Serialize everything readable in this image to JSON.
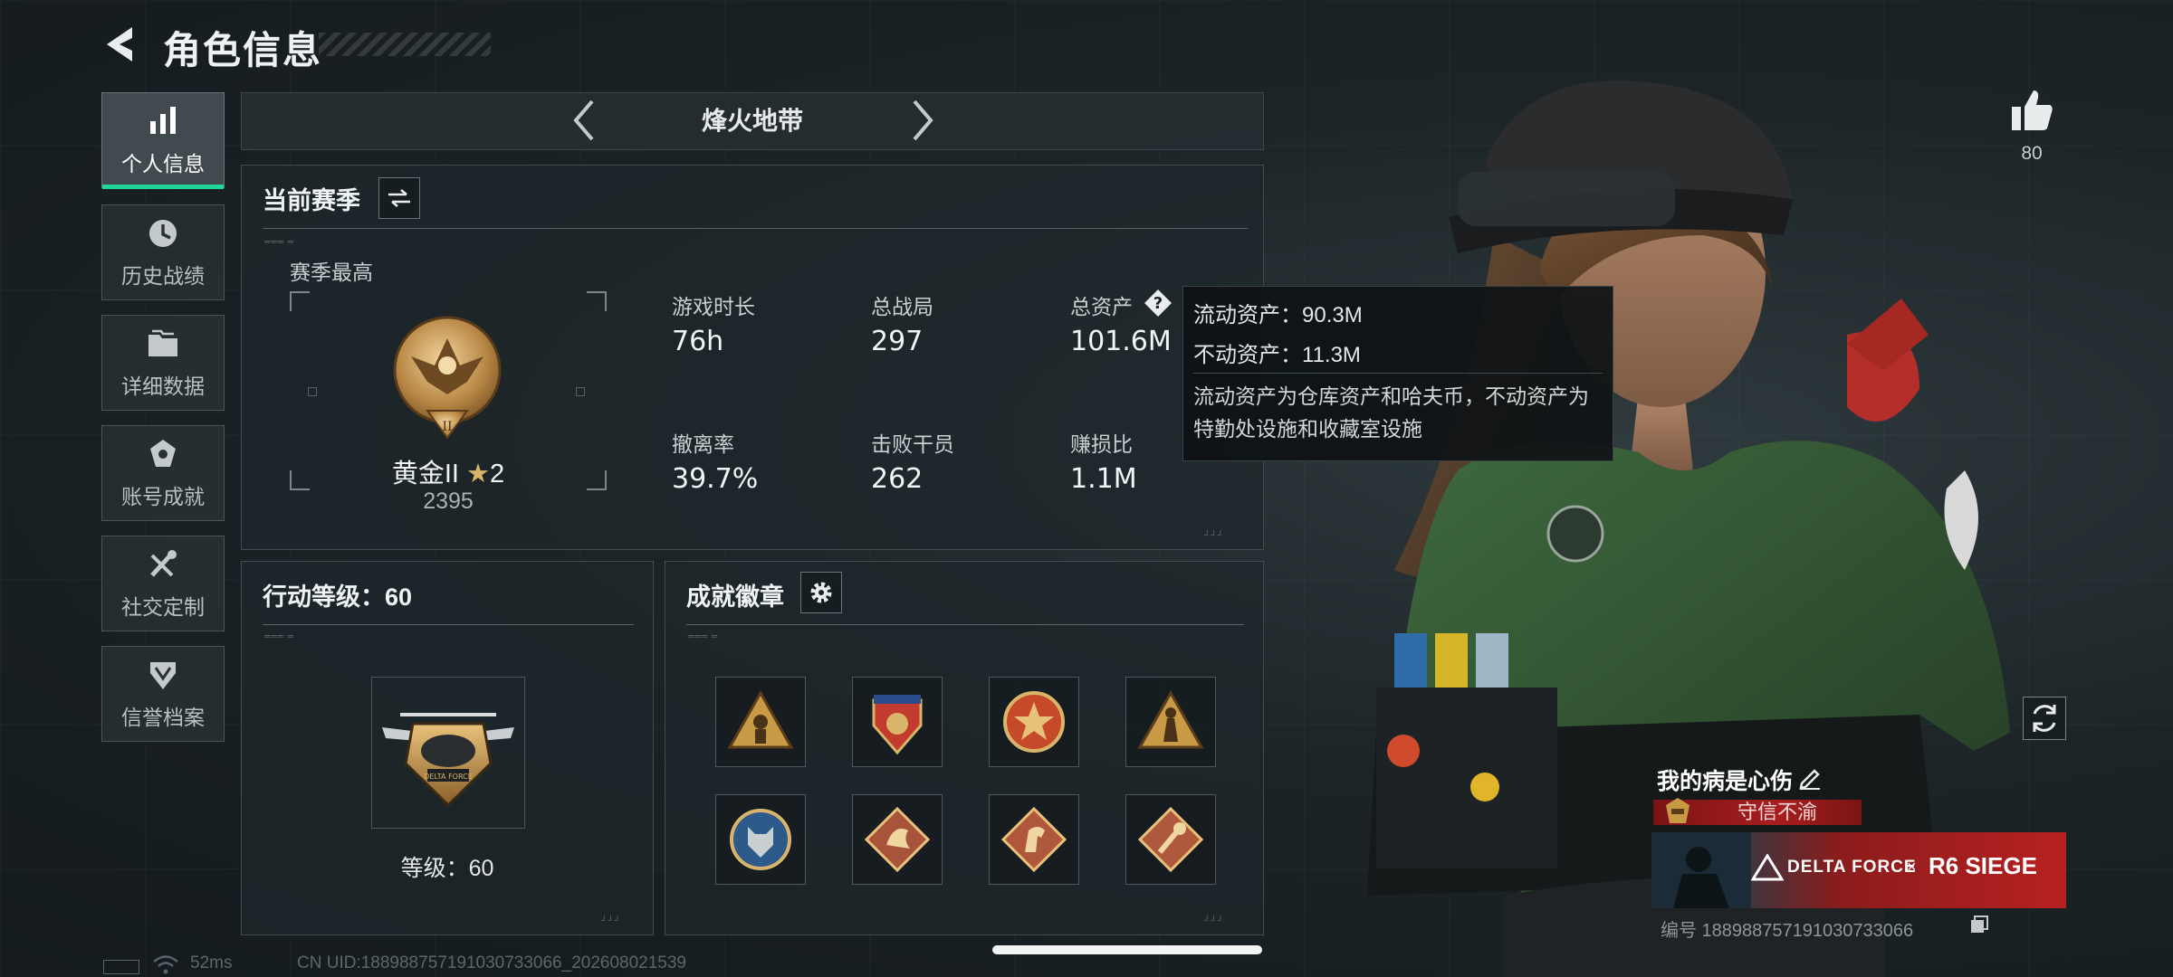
{
  "header": {
    "title": "角色信息"
  },
  "sidebar": {
    "items": [
      {
        "label": "个人信息",
        "icon": "bar-chart-icon",
        "active": true
      },
      {
        "label": "历史战绩",
        "icon": "history-clock-icon",
        "active": false
      },
      {
        "label": "详细数据",
        "icon": "folder-icon",
        "active": false
      },
      {
        "label": "账号成就",
        "icon": "achievement-icon",
        "active": false
      },
      {
        "label": "社交定制",
        "icon": "tools-icon",
        "active": false
      },
      {
        "label": "信誉档案",
        "icon": "credit-shield-icon",
        "active": false
      }
    ]
  },
  "mode_selector": {
    "current": "烽火地带"
  },
  "season": {
    "title": "当前赛季",
    "best_label": "赛季最高",
    "rank_name": "黄金II",
    "rank_stars": "2",
    "rank_score": "2395",
    "stats": [
      {
        "label": "游戏时长",
        "value": "76h"
      },
      {
        "label": "总战局",
        "value": "297"
      },
      {
        "label": "总资产",
        "value": "101.6M"
      },
      {
        "label": "撤离率",
        "value": "39.7%"
      },
      {
        "label": "击败干员",
        "value": "262"
      },
      {
        "label": "赚损比",
        "value": "1.1M"
      }
    ]
  },
  "tooltip": {
    "liquid": "流动资产：90.3M",
    "fixed": "不动资产：11.3M",
    "desc": "流动资产为仓库资产和哈夫币，不动资产为特勤处设施和收藏室设施"
  },
  "action_level": {
    "title": "行动等级：60",
    "level_text": "等级：60"
  },
  "badges": {
    "title": "成就徽章",
    "items": [
      {
        "icon": "badge-soldier-triangle-icon",
        "color": "#c89a45"
      },
      {
        "icon": "badge-shield-stars-icon",
        "color": "#c33a2e"
      },
      {
        "icon": "badge-star-circle-icon",
        "color": "#c64a2a"
      },
      {
        "icon": "badge-figure-triangle-icon",
        "color": "#c89a45"
      },
      {
        "icon": "badge-wolf-circle-icon",
        "color": "#2c5a8a"
      },
      {
        "icon": "badge-dragon-diamond-icon",
        "color": "#a8543a"
      },
      {
        "icon": "badge-horse-diamond-icon",
        "color": "#b0583c"
      },
      {
        "icon": "badge-wrench-diamond-icon",
        "color": "#b0583c"
      }
    ]
  },
  "profile": {
    "likes": "80",
    "name": "我的病是心伤",
    "title": "守信不渝",
    "banner_left": "DELTA FORCE",
    "banner_x": "×",
    "banner_right": "R6 SIEGE",
    "id_text": "编号 1889887571910307330​66"
  },
  "footer": {
    "ping": "52ms",
    "uid": "CN UID:18898875719103​07330​66_202608021539"
  },
  "colors": {
    "accent": "#1fd59a",
    "title_red": "#a81e1e"
  }
}
